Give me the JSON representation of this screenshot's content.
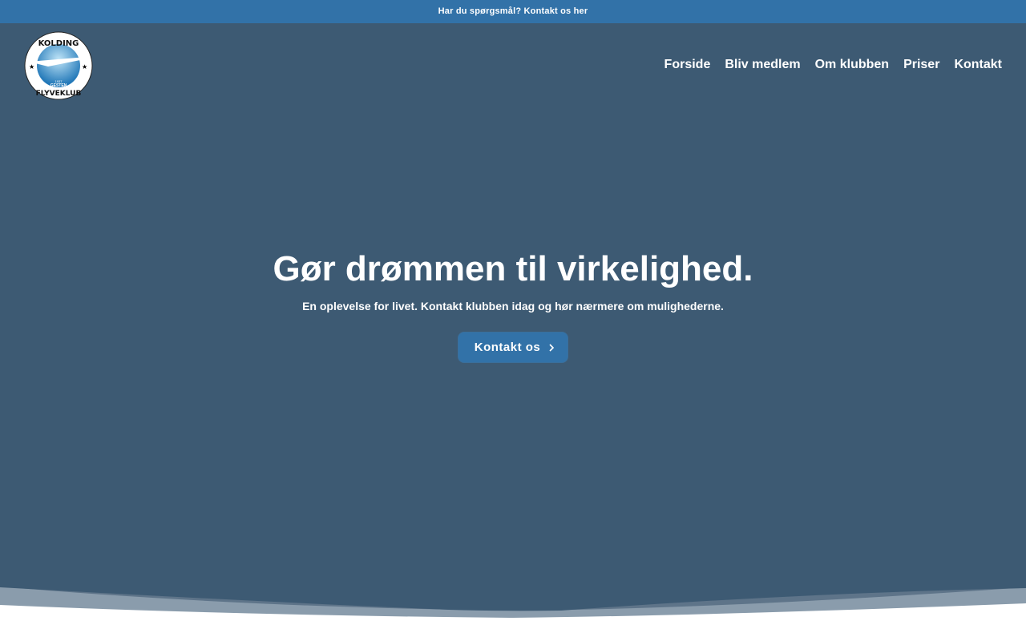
{
  "topbar": {
    "text": "Har du spørgsmål? Kontakt os her"
  },
  "logo": {
    "top_text": "KOLDING",
    "bottom_text": "FLYVEKLUB",
    "year": "1937",
    "place": "GESTEN"
  },
  "nav": {
    "items": [
      "Forside",
      "Bliv medlem",
      "Om klubben",
      "Priser",
      "Kontakt"
    ]
  },
  "hero": {
    "title": "Gør drømmen til virkelighed.",
    "subtitle": "En oplevelse for livet. Kontakt klubben idag og hør nærmere om mulighederne.",
    "button": "Kontakt os",
    "button_icon": "chevron-right-icon"
  },
  "colors": {
    "topbar": "#3272a8",
    "hero": "#3d5a73",
    "button": "#3272a8"
  }
}
